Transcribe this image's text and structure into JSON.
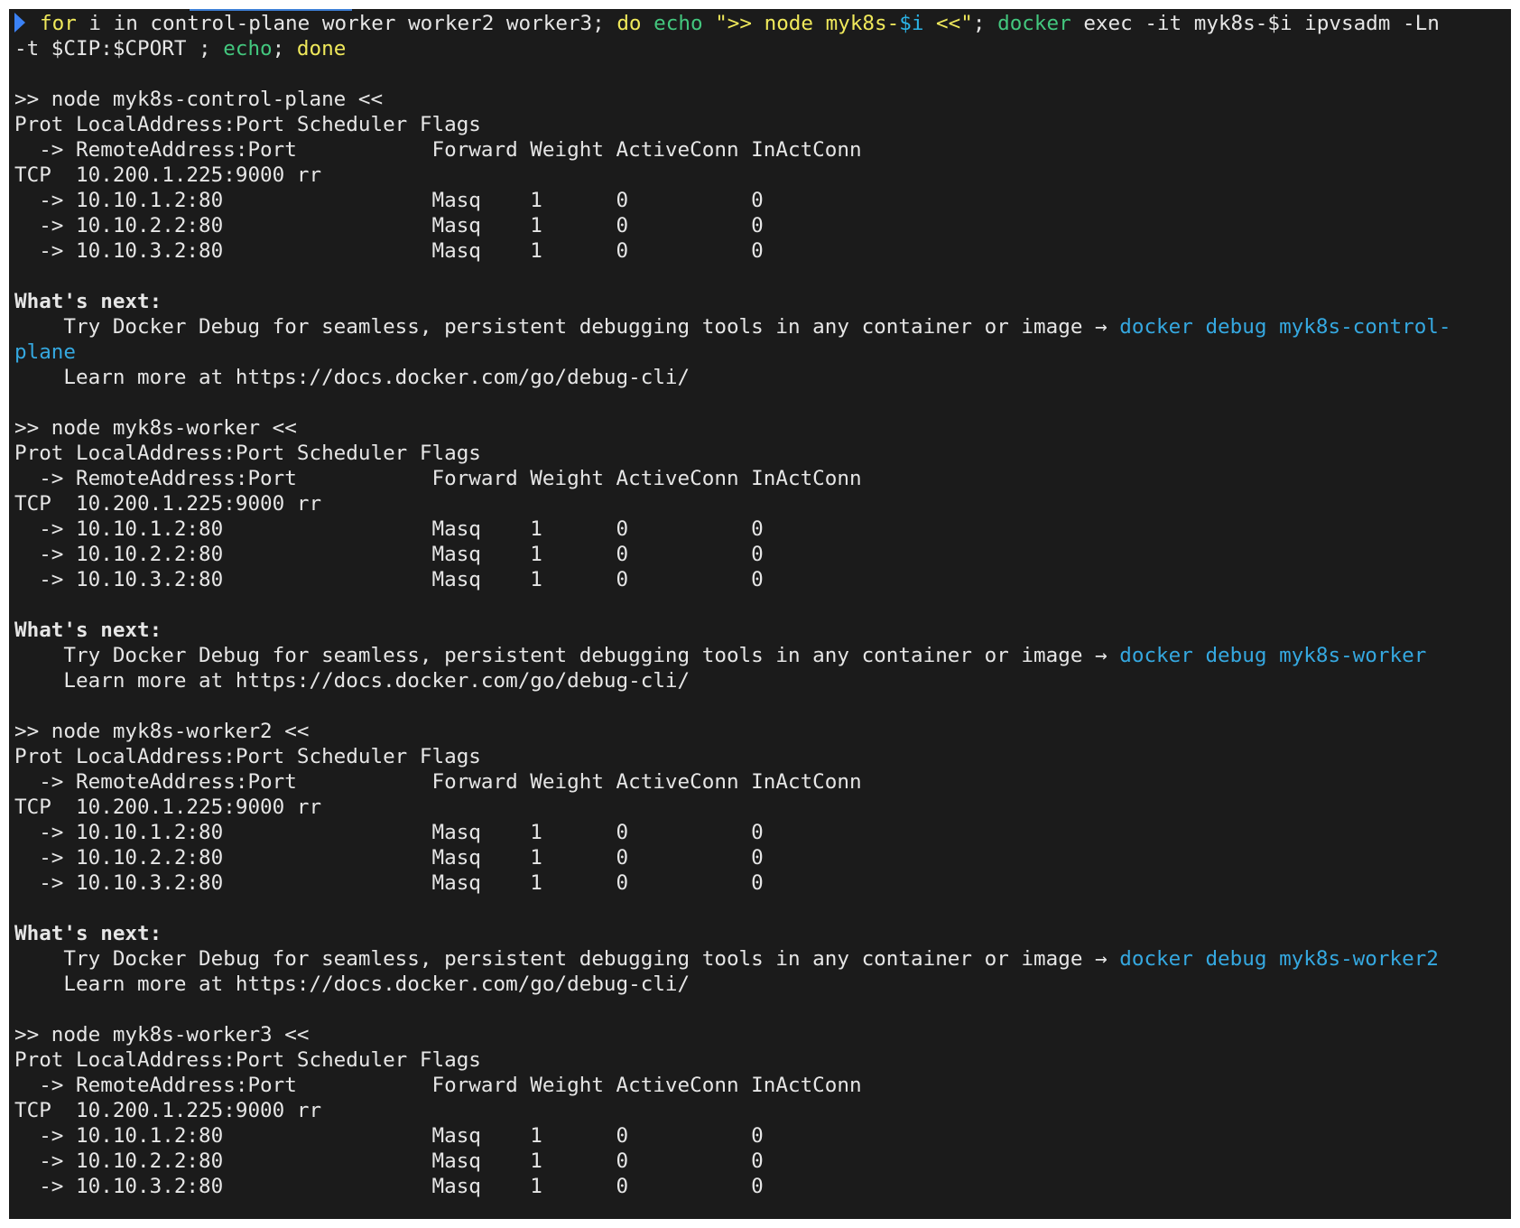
{
  "command": {
    "line1": {
      "t1": "for",
      "t2": " i in control-plane worker worker2 worker3; ",
      "t3": "do",
      "t4": " ",
      "t5": "echo",
      "t6": " ",
      "t7": "\">> node myk8s-",
      "t8": "$i",
      "t9": " <<\"",
      "t10": "; ",
      "t11": "docker",
      "t12": " exec -it myk8s-$i ipvsadm -Ln"
    },
    "line2": {
      "t1": "-t $CIP:$CPORT ; ",
      "t2": "echo",
      "t3": "; ",
      "t4": "done"
    }
  },
  "blocks": [
    {
      "header": ">> node myk8s-control-plane <<",
      "col1": "Prot LocalAddress:Port Scheduler Flags",
      "col2": "  -> RemoteAddress:Port           Forward Weight ActiveConn InActConn",
      "service": "TCP  10.200.1.225:9000 rr",
      "rows": [
        "  -> 10.10.1.2:80                 Masq    1      0          0",
        "  -> 10.10.2.2:80                 Masq    1      0          0",
        "  -> 10.10.3.2:80                 Masq    1      0          0"
      ],
      "next_title": "What's next:",
      "tip_text": "    Try Docker Debug for seamless, persistent debugging tools in any container or image → ",
      "tip_cmd": "docker debug myk8s-control-",
      "tip_cmd_wrap": "plane",
      "learn": "    Learn more at https://docs.docker.com/go/debug-cli/"
    },
    {
      "header": ">> node myk8s-worker <<",
      "col1": "Prot LocalAddress:Port Scheduler Flags",
      "col2": "  -> RemoteAddress:Port           Forward Weight ActiveConn InActConn",
      "service": "TCP  10.200.1.225:9000 rr",
      "rows": [
        "  -> 10.10.1.2:80                 Masq    1      0          0",
        "  -> 10.10.2.2:80                 Masq    1      0          0",
        "  -> 10.10.3.2:80                 Masq    1      0          0"
      ],
      "next_title": "What's next:",
      "tip_text": "    Try Docker Debug for seamless, persistent debugging tools in any container or image → ",
      "tip_cmd": "docker debug myk8s-worker",
      "learn": "    Learn more at https://docs.docker.com/go/debug-cli/"
    },
    {
      "header": ">> node myk8s-worker2 <<",
      "col1": "Prot LocalAddress:Port Scheduler Flags",
      "col2": "  -> RemoteAddress:Port           Forward Weight ActiveConn InActConn",
      "service": "TCP  10.200.1.225:9000 rr",
      "rows": [
        "  -> 10.10.1.2:80                 Masq    1      0          0",
        "  -> 10.10.2.2:80                 Masq    1      0          0",
        "  -> 10.10.3.2:80                 Masq    1      0          0"
      ],
      "next_title": "What's next:",
      "tip_text": "    Try Docker Debug for seamless, persistent debugging tools in any container or image → ",
      "tip_cmd": "docker debug myk8s-worker2",
      "learn": "    Learn more at https://docs.docker.com/go/debug-cli/"
    },
    {
      "header": ">> node myk8s-worker3 <<",
      "col1": "Prot LocalAddress:Port Scheduler Flags",
      "col2": "  -> RemoteAddress:Port           Forward Weight ActiveConn InActConn",
      "service": "TCP  10.200.1.225:9000 rr",
      "rows": [
        "  -> 10.10.1.2:80                 Masq    1      0          0",
        "  -> 10.10.2.2:80                 Masq    1      0          0",
        "  -> 10.10.3.2:80                 Masq    1      0          0"
      ]
    }
  ],
  "colors": {
    "background": "#1b1b1b",
    "text": "#e6e6e6",
    "keyword": "#f0e95b",
    "builtin": "#43c77e",
    "variable": "#2bb3e6",
    "link": "#35a8e0",
    "prompt": "#3b82f6"
  }
}
